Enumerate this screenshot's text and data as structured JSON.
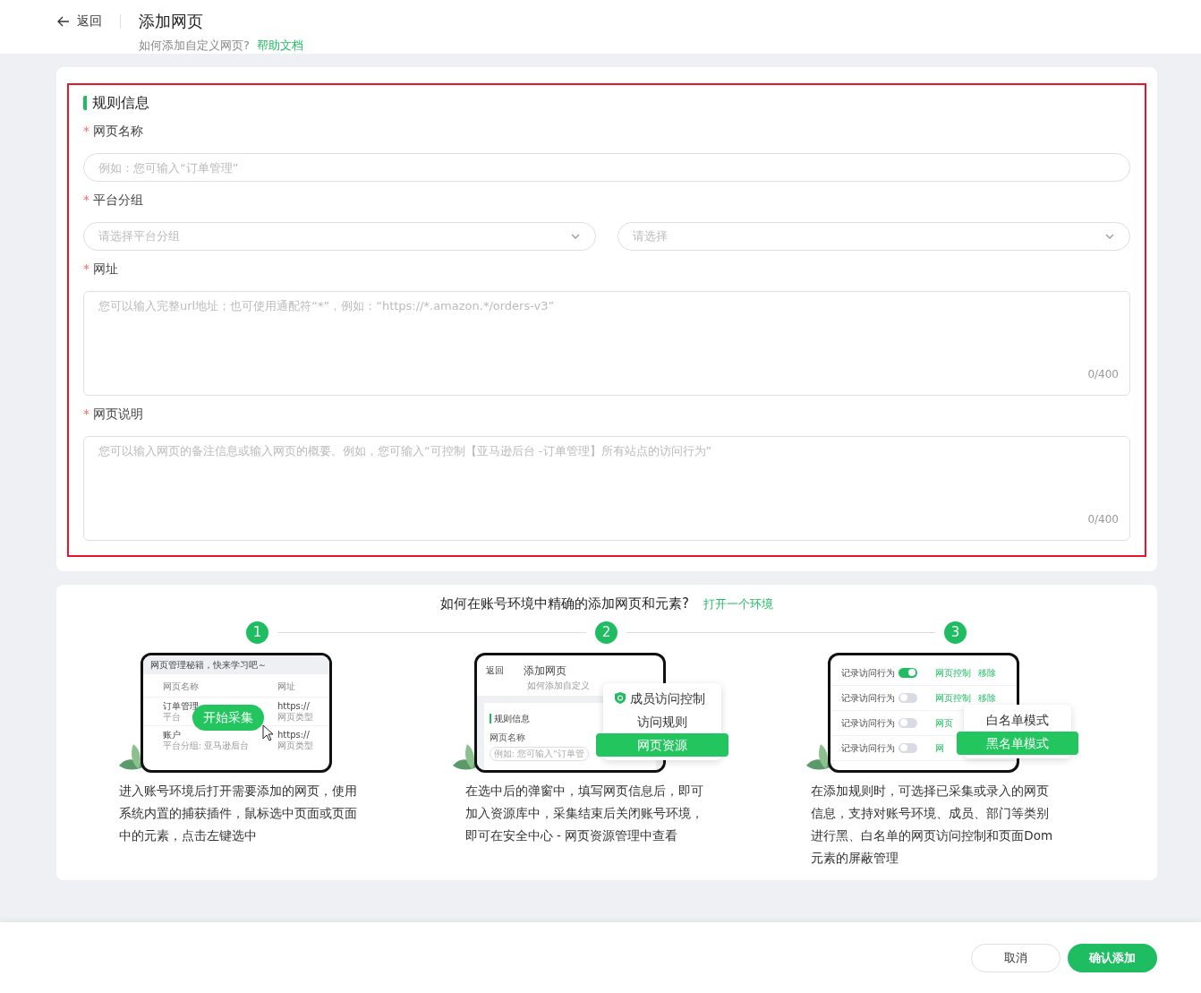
{
  "header": {
    "back_label": "返回",
    "title": "添加网页",
    "subtitle": "如何添加自定义网页?",
    "help_link": "帮助文档"
  },
  "form": {
    "section_title": "规则信息",
    "fields": [
      {
        "kind": "input",
        "label": "网页名称",
        "required_mark": "*",
        "placeholder": "例如：您可输入“订单管理”"
      },
      {
        "kind": "select-pair",
        "label": "平台分组",
        "required_mark": "*",
        "selects": [
          {
            "placeholder": "请选择平台分组"
          },
          {
            "placeholder": "请选择"
          }
        ]
      },
      {
        "kind": "textarea",
        "label": "网址",
        "required_mark": "*",
        "placeholder": "您可以输入完整url地址；也可使用通配符“*”，例如：“https://*.amazon.*/orders-v3”",
        "counter": "0/400"
      },
      {
        "kind": "textarea",
        "label": "网页说明",
        "required_mark": "*",
        "placeholder": "您可以输入网页的备注信息或输入网页的概要。例如，您可输入“可控制【亚马逊后台 -订单管理】所有站点的访问行为”",
        "counter": "0/400"
      }
    ]
  },
  "guide": {
    "question": "如何在账号环境中精确的添加网页和元素?",
    "link": "打开一个环境",
    "steps": [
      {
        "number": "1",
        "mock": {
          "kind": "table",
          "banner": "网页管理秘籍，快来学习吧～",
          "columns": [
            "网页名称",
            "网址"
          ],
          "rows": [
            {
              "name": "订单管理",
              "sub": "平台",
              "url": "https://",
              "url_sub": "网页类型"
            },
            {
              "name": "账户",
              "sub": "平台分组: 亚马逊后台",
              "url": "https://",
              "url_sub": "网页类型"
            }
          ],
          "action": "开始采集"
        },
        "description": "进入账号环境后打开需要添加的网页，使用系统内置的捕获插件，鼠标选中页面或页面中的元素，点击左键选中"
      },
      {
        "number": "2",
        "mock": {
          "kind": "menu",
          "back": "返回",
          "title": "添加网页",
          "subtitle": "如何添加自定义",
          "section": "规则信息",
          "field_label": "网页名称",
          "placeholder": "例如: 您可输入“订单管",
          "items": [
            {
              "label": "成员访问控制",
              "selected": false,
              "icon": true
            },
            {
              "label": "访问规则",
              "selected": false,
              "icon": false
            },
            {
              "label": "网页资源",
              "selected": true,
              "icon": false
            }
          ]
        },
        "description": "在选中后的弹窗中，填写网页信息后，即可加入资源库中，采集结束后关闭账号环境，即可在安全中心 - 网页资源管理中查看"
      },
      {
        "number": "3",
        "mock": {
          "kind": "toggles",
          "rows": [
            {
              "label": "记录访问行为",
              "on": true,
              "links": [
                "网页控制",
                "移除"
              ]
            },
            {
              "label": "记录访问行为",
              "on": false,
              "links": [
                "网页控制",
                "移除"
              ]
            },
            {
              "label": "记录访问行为",
              "on": false,
              "links": [
                "网页"
              ]
            },
            {
              "label": "记录访问行为",
              "on": false,
              "links": [
                "网"
              ]
            }
          ],
          "items": [
            {
              "label": "白名单模式",
              "selected": false,
              "icon": false
            },
            {
              "label": "黑名单模式",
              "selected": true,
              "icon": false
            }
          ]
        },
        "description": "在添加规则时，可选择已采集或录入的网页信息，支持对账号环境、成员、部门等类别进行黑、白名单的网页访问控制和页面Dom元素的屏蔽管理"
      }
    ]
  },
  "footer": {
    "buttons": [
      {
        "label": "取消",
        "kind": "secondary"
      },
      {
        "label": "确认添加",
        "kind": "primary"
      }
    ]
  }
}
